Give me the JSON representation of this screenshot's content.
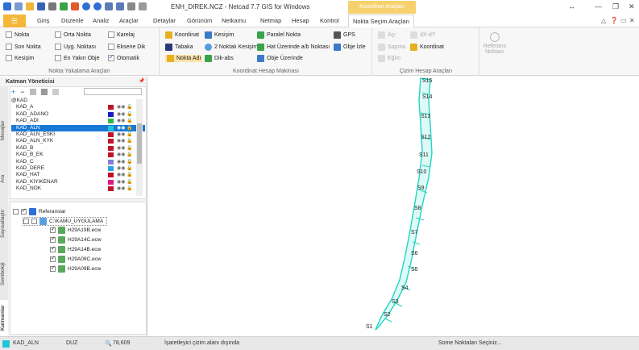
{
  "window": {
    "title": "ENH_DIREK.NCZ - Netcad 7.7 GIS for Windows",
    "context_tab": "Koordinat Araçları",
    "controls": [
      "↔",
      "—",
      "❐",
      "✕"
    ]
  },
  "tabs": {
    "file_icon": "☰",
    "items": [
      "Giriş",
      "Düzenle",
      "Analiz",
      "Araçlar",
      "Detaylar",
      "Görünüm",
      "Netkamu",
      "Netmap",
      "Hesap",
      "Kontrol",
      "Nokta Seçim Araçları"
    ],
    "right_icons": [
      "△",
      "❓",
      "▭",
      "✕"
    ]
  },
  "ribbon": {
    "snap_group": {
      "label": "Nokta Yakalama Araçları",
      "items": [
        {
          "label": "Nokta",
          "checked": false
        },
        {
          "label": "Orta Nokta",
          "checked": false
        },
        {
          "label": "Karelaj",
          "checked": false
        },
        {
          "label": "Son Nokta",
          "checked": false
        },
        {
          "label": "Uyg. Noktası",
          "checked": false
        },
        {
          "label": "Eksene Dik",
          "checked": false
        },
        {
          "label": "Kesişim",
          "checked": false
        },
        {
          "label": "En Yakın Obje",
          "checked": false
        },
        {
          "label": "Otomatik",
          "checked": true
        }
      ]
    },
    "calc_group": {
      "label": "Koordinat Hesap Makinası",
      "items": [
        "Koordinat",
        "Kesişim",
        "Paralel Nokta",
        "GPS",
        "Tabaka",
        "2 Noktalı Kesişim",
        "Hat Üzerinde a/b Noktası",
        "Obje İzle",
        "Nokta Adı",
        "Dik-abs",
        "Obje Üzerinde"
      ]
    },
    "draw_group": {
      "label": "Çizim Hesap Araçları",
      "items": [
        "Açı",
        "dX-dY",
        "Sapma",
        "Koordinat",
        "Eğim"
      ],
      "ref_point": "Referans Noktası"
    }
  },
  "panel": {
    "title": "Katman Yöneticisi",
    "pin": "📌",
    "vtabs": [
      "Mesajlar",
      "Ara",
      "Sayısallaştır",
      "Semboloji",
      "Katmanlar"
    ],
    "layers": [
      {
        "name": "@KAD",
        "color": "",
        "header": true
      },
      {
        "name": "KAD_A",
        "color": "#c0142a"
      },
      {
        "name": "KAD_ADANO",
        "color": "#1a1ac8"
      },
      {
        "name": "KAD_ADI",
        "color": "#2eb84a"
      },
      {
        "name": "KAD_ALN",
        "color": "#22c5d8",
        "selected": true
      },
      {
        "name": "KAD_ALN_ESKI",
        "color": "#c0142a"
      },
      {
        "name": "KAD_ALN_KYK",
        "color": "#c0142a"
      },
      {
        "name": "KAD_B",
        "color": "#c0142a"
      },
      {
        "name": "KAD_B_EK",
        "color": "#c0142a"
      },
      {
        "name": "KAD_C",
        "color": "#8a7ad8"
      },
      {
        "name": "KAD_DERE",
        "color": "#2ba4e0"
      },
      {
        "name": "KAD_HAT",
        "color": "#c0142a"
      },
      {
        "name": "KAD_KIYIKENAR",
        "color": "#e0188a"
      },
      {
        "name": "KAD_NOK",
        "color": "#c0142a"
      }
    ],
    "layer_flags": "◉◉ 🔒",
    "references": {
      "root": "Referanslar",
      "folder": "C:\\KAMU_UYGULAMA",
      "files": [
        "H29A19B.ecw",
        "H29A14C.ecw",
        "H29A14B.ecw",
        "H29A09C.ecw",
        "H29A09B.ecw"
      ]
    }
  },
  "map": {
    "labels": [
      "S15",
      "S14",
      "S13",
      "S12",
      "S11",
      "S10",
      "S9",
      "S8",
      "S7",
      "S6",
      "S5",
      "S4",
      "S3",
      "S2",
      "S1"
    ],
    "parcel_color": "#1fd6c4"
  },
  "status": {
    "layer": "KAD_ALN",
    "mode": "DUZ",
    "zoom": "78,609",
    "message": "İşaretleyici çizim alanı dışında",
    "prompt": "Some Noktaları Seçiniz..."
  }
}
